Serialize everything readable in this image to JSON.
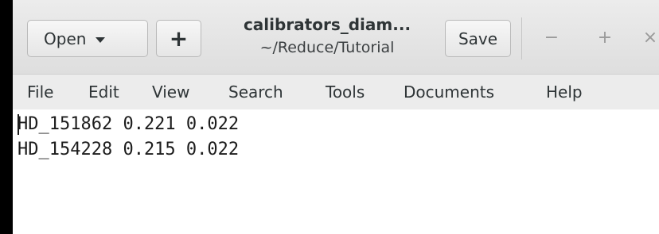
{
  "header": {
    "open_label": "Open",
    "new_label": "+",
    "title": "calibrators_diam...",
    "subtitle": "~/Reduce/Tutorial",
    "save_label": "Save",
    "minimize_glyph": "−",
    "maximize_glyph": "+",
    "close_glyph": "×"
  },
  "menu": {
    "items": [
      "File",
      "Edit",
      "View",
      "Search",
      "Tools",
      "Documents",
      "Help"
    ]
  },
  "editor": {
    "lines": [
      "HD_151862 0.221 0.022",
      "HD_154228 0.215 0.022"
    ]
  }
}
